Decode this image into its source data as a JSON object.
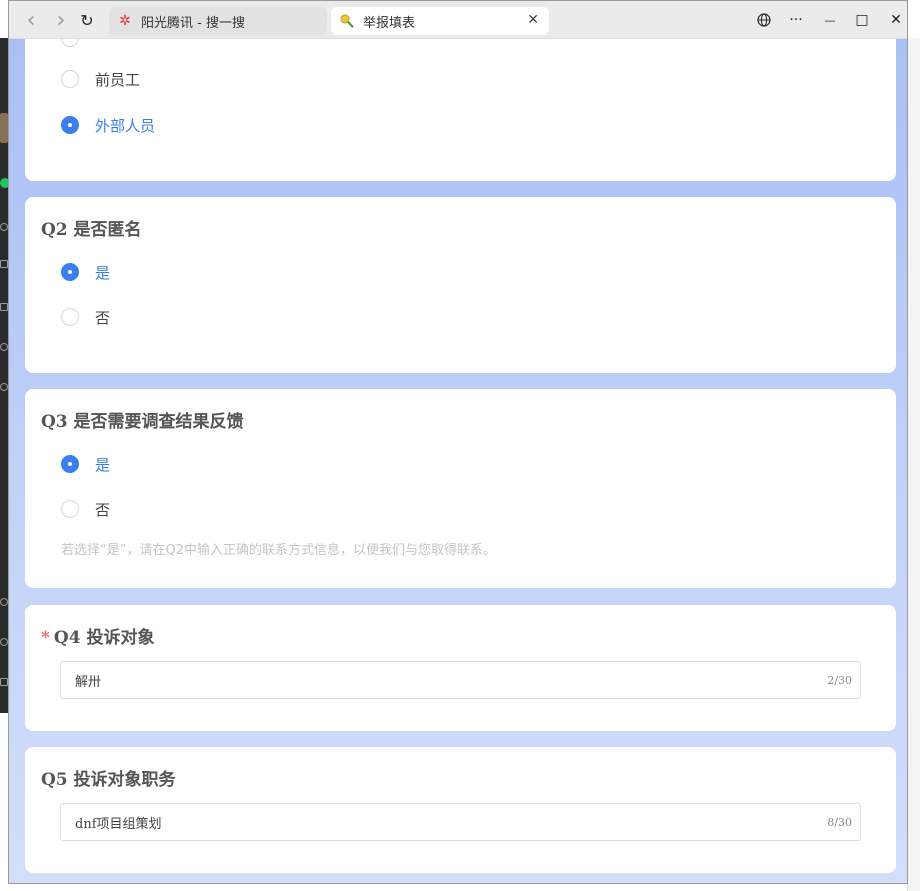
{
  "browser": {
    "tabs": [
      {
        "title": "阳光腾讯 - 搜一搜",
        "icon": "star-logo-icon",
        "active": false
      },
      {
        "title": "举报填表",
        "icon": "search-page-icon",
        "active": true
      }
    ],
    "buttons": {
      "back": "‹",
      "forward": "›",
      "refresh": "↻",
      "globe": "🌐",
      "more": "···",
      "minimize": "—",
      "maximize": "□",
      "close": "✕",
      "tab_close": "✕"
    }
  },
  "colors": {
    "accent": "#3a7ef0",
    "page_bg_top": "#a9c0f4",
    "page_bg_bottom": "#d3defb"
  },
  "form": {
    "q1": {
      "options": [
        {
          "label": "前员工",
          "checked": false
        },
        {
          "label": "外部人员",
          "checked": true
        }
      ]
    },
    "q2": {
      "title": "Q2 是否匿名",
      "options": [
        {
          "label": "是",
          "checked": true
        },
        {
          "label": "否",
          "checked": false
        }
      ]
    },
    "q3": {
      "title": "Q3 是否需要调查结果反馈",
      "options": [
        {
          "label": "是",
          "checked": true
        },
        {
          "label": "否",
          "checked": false
        }
      ],
      "hint": "若选择“是”，请在Q2中输入正确的联系方式信息，以便我们与您取得联系。"
    },
    "q4": {
      "required_mark": "*",
      "title": "Q4 投诉对象",
      "value": "解卅",
      "counter": "2/30"
    },
    "q5": {
      "title": "Q5 投诉对象职务",
      "value": "dnf项目组策划",
      "counter": "8/30"
    }
  }
}
